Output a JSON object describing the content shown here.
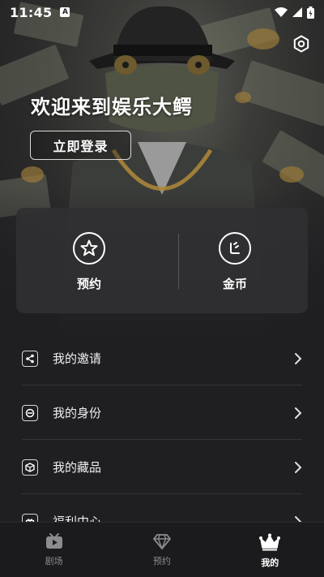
{
  "status_bar": {
    "time": "11:45",
    "notif_letter": "A"
  },
  "header": {
    "welcome": "欢迎来到娱乐大鳄",
    "login_label": "立即登录"
  },
  "stats": [
    {
      "label": "预约",
      "icon": "star-icon"
    },
    {
      "label": "金币",
      "icon": "coin-icon"
    }
  ],
  "menu": [
    {
      "label": "我的邀请",
      "icon": "share-icon"
    },
    {
      "label": "我的身份",
      "icon": "identity-icon"
    },
    {
      "label": "我的藏品",
      "icon": "collection-box-icon"
    },
    {
      "label": "福利中心",
      "icon": "gift-icon"
    }
  ],
  "nav": [
    {
      "label": "剧场",
      "icon": "theater-play-icon",
      "active": false
    },
    {
      "label": "预约",
      "icon": "diamond-icon",
      "active": false
    },
    {
      "label": "我的",
      "icon": "crown-icon",
      "active": true
    }
  ]
}
